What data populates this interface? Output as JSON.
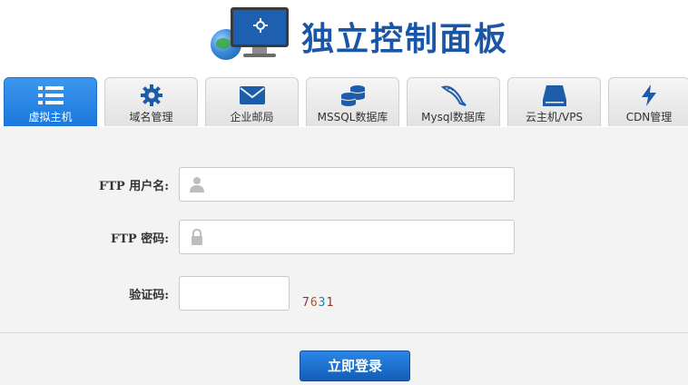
{
  "header": {
    "title": "独立控制面板"
  },
  "tabs": [
    {
      "label": "虚拟主机",
      "icon": "list-icon",
      "active": true
    },
    {
      "label": "域名管理",
      "icon": "gear-icon",
      "active": false
    },
    {
      "label": "企业邮局",
      "icon": "mail-icon",
      "active": false
    },
    {
      "label": "MSSQL数据库",
      "icon": "database-icon",
      "active": false
    },
    {
      "label": "Mysql数据库",
      "icon": "dolphin-icon",
      "active": false
    },
    {
      "label": "云主机/VPS",
      "icon": "server-icon",
      "active": false
    },
    {
      "label": "CDN管理",
      "icon": "lightning-icon",
      "active": false
    }
  ],
  "form": {
    "username_label": "FTP 用户名:",
    "username_value": "",
    "password_label": "FTP 密码:",
    "password_value": "",
    "captcha_label": "验证码:",
    "captcha_value": "",
    "captcha_digits": [
      "7",
      "6",
      "3",
      "1"
    ],
    "captcha_colors": [
      "#8b2f4e",
      "#b6531d",
      "#2a7cb5",
      "#9b2a2a"
    ],
    "submit_label": "立即登录"
  },
  "colors": {
    "accent": "#1a77dc",
    "title": "#1a56a8"
  }
}
